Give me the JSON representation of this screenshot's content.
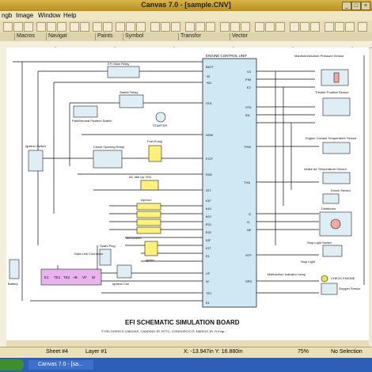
{
  "window": {
    "title": "Canvas 7.0 - [sample.CNV]"
  },
  "menu": [
    "ngb",
    "Image",
    "Window",
    "Help"
  ],
  "toolbar_groups": [
    "Macros",
    "Navigat",
    "Paints",
    "Symbol",
    "Transfor",
    "Vector"
  ],
  "diagram": {
    "ecu_title": "ENGINE CONTROL UNIT",
    "ecu_left_pins": [
      "BATT",
      "+B",
      "+B1",
      "STA",
      "NSW",
      "F/OT",
      "R/W",
      "IGT",
      "IGF",
      "#10",
      "#20",
      "E01",
      "E02",
      "IGF",
      "IGT",
      "E1",
      "VF",
      "W",
      "TE1",
      "E1"
    ],
    "ecu_right_pins": [
      "VC",
      "PIM",
      "E2",
      "VTA",
      "IDL",
      "THW",
      "THA",
      "G",
      "G-",
      "NE",
      "STP",
      "SPD"
    ],
    "components": {
      "efi_relay": "EFI Main Relay",
      "starter_relay": "Starter Relay",
      "park_neutral": "Park/Neutral Position Switch",
      "starter": "STARTER",
      "ignition_switch": "Ignition Switch",
      "circuit_opening_relay": "Circuit Opening Relay",
      "fuel_pump": "Fuel Pump",
      "injector": "Injector",
      "ac_idle": "AC Idle Up VSV",
      "tachometer": "Tachometer",
      "igniter": "Igniter",
      "spark_plug": "Spark Plug",
      "ignition_coil": "Ignition Coil",
      "data_link": "Data Link Connector",
      "battery": "Battery",
      "map_sensor": "Manifold Absolute Pressure Sensor",
      "tps": "Throttle Position Sensor",
      "ect": "Engine Coolant Temperature Sensor",
      "iat": "Intake Air Temperature Sensor",
      "knock": "Knock Sensor",
      "distributor": "Distributor",
      "stop_switch": "Stop Light Switch",
      "stop_light": "Stop Light",
      "mil": "Malfunction Indicator Lamp",
      "check_engine": "CHECK ENGINE",
      "o2": "Oxygen Sensor"
    },
    "dlc_pins": [
      "E1",
      "TE1",
      "TE2",
      "+B",
      "VF",
      "W"
    ],
    "board_title": "EFI SCHEMATIC SIMULATION BOARD",
    "credits": "© PELOGRIO'S CABIGAS, CANDINO JR, NTTC, CONSORCIO S. NARIOS JR, R.Engr."
  },
  "status": {
    "sheet": "Sheet #4",
    "layer": "Layer #1",
    "coords": "X: -13.947in Y: 16.880in",
    "zoom": "75%",
    "selection": "No Selection"
  },
  "taskbar": {
    "item": "Canvas 7.0 - [sa..."
  },
  "colors": {
    "titlebar": "#c9a535",
    "canvas_bg": "#ffffff",
    "ecu_fill": "#cfe8f3",
    "taskbar": "#2d5fb8"
  }
}
